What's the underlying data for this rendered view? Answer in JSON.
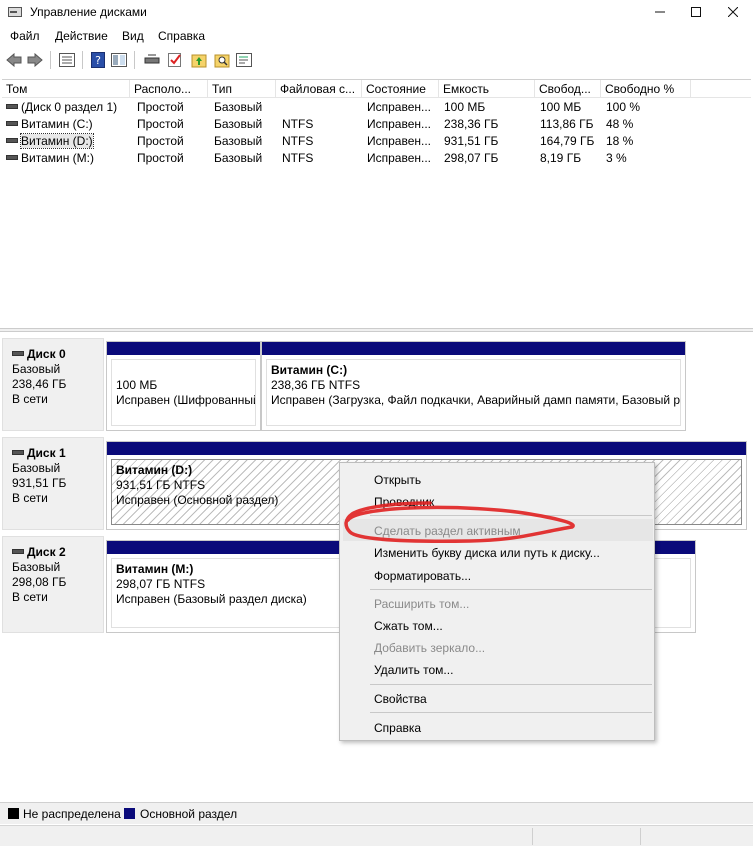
{
  "window": {
    "title": "Управление дисками"
  },
  "menu": [
    "Файл",
    "Действие",
    "Вид",
    "Справка"
  ],
  "toolbar": [
    "back-icon",
    "forward-icon",
    "list-view-icon",
    "help-icon",
    "connect-icon",
    "check-icon",
    "up-folder-icon",
    "search-folder-icon",
    "properties-icon"
  ],
  "volume_list": {
    "columns": [
      "Том",
      "Располо...",
      "Тип",
      "Файловая с...",
      "Состояние",
      "Емкость",
      "Свобод...",
      "Свободно %"
    ],
    "rows": [
      [
        "(Диск 0 раздел 1)",
        "Простой",
        "Базовый",
        "",
        "Исправен...",
        "100 МБ",
        "100 МБ",
        "100 %"
      ],
      [
        "Витамин (C:)",
        "Простой",
        "Базовый",
        "NTFS",
        "Исправен...",
        "238,36 ГБ",
        "113,86 ГБ",
        "48 %"
      ],
      [
        "Витамин (D:)",
        "Простой",
        "Базовый",
        "NTFS",
        "Исправен...",
        "931,51 ГБ",
        "164,79 ГБ",
        "18 %"
      ],
      [
        "Витамин (M:)",
        "Простой",
        "Базовый",
        "NTFS",
        "Исправен...",
        "298,07 ГБ",
        "8,19 ГБ",
        "3 %"
      ]
    ]
  },
  "disks": [
    {
      "name": "Диск 0",
      "type": "Базовый",
      "size": "238,46 ГБ",
      "status": "В сети",
      "partitions": [
        {
          "title": "",
          "size": "100 МБ",
          "status": "Исправен (Шифрованный"
        },
        {
          "title": "Витамин  (C:)",
          "size": "238,36 ГБ NTFS",
          "status": "Исправен (Загрузка, Файл подкачки, Аварийный дамп памяти, Базовый р"
        }
      ]
    },
    {
      "name": "Диск 1",
      "type": "Базовый",
      "size": "931,51 ГБ",
      "status": "В сети",
      "partitions": [
        {
          "title": "Витамин  (D:)",
          "size": "931,51 ГБ NTFS",
          "status": "Исправен (Основной раздел)"
        }
      ]
    },
    {
      "name": "Диск 2",
      "type": "Базовый",
      "size": "298,08 ГБ",
      "status": "В сети",
      "partitions": [
        {
          "title": "Витамин  (M:)",
          "size": "298,07 ГБ NTFS",
          "status": "Исправен (Базовый раздел диска)"
        }
      ]
    }
  ],
  "context_menu": {
    "open": "Открыть",
    "explorer": "Проводник",
    "mark_active": "Сделать раздел активным",
    "change_letter": "Изменить букву диска или путь к диску...",
    "format": "Форматировать...",
    "extend": "Расширить том...",
    "shrink": "Сжать том...",
    "add_mirror": "Добавить зеркало...",
    "delete": "Удалить том...",
    "properties": "Свойства",
    "help": "Справка"
  },
  "legend": {
    "unallocated": "Не распределена",
    "primary": "Основной раздел",
    "unallocated_color": "#000000",
    "primary_color": "#0a0a7a"
  }
}
